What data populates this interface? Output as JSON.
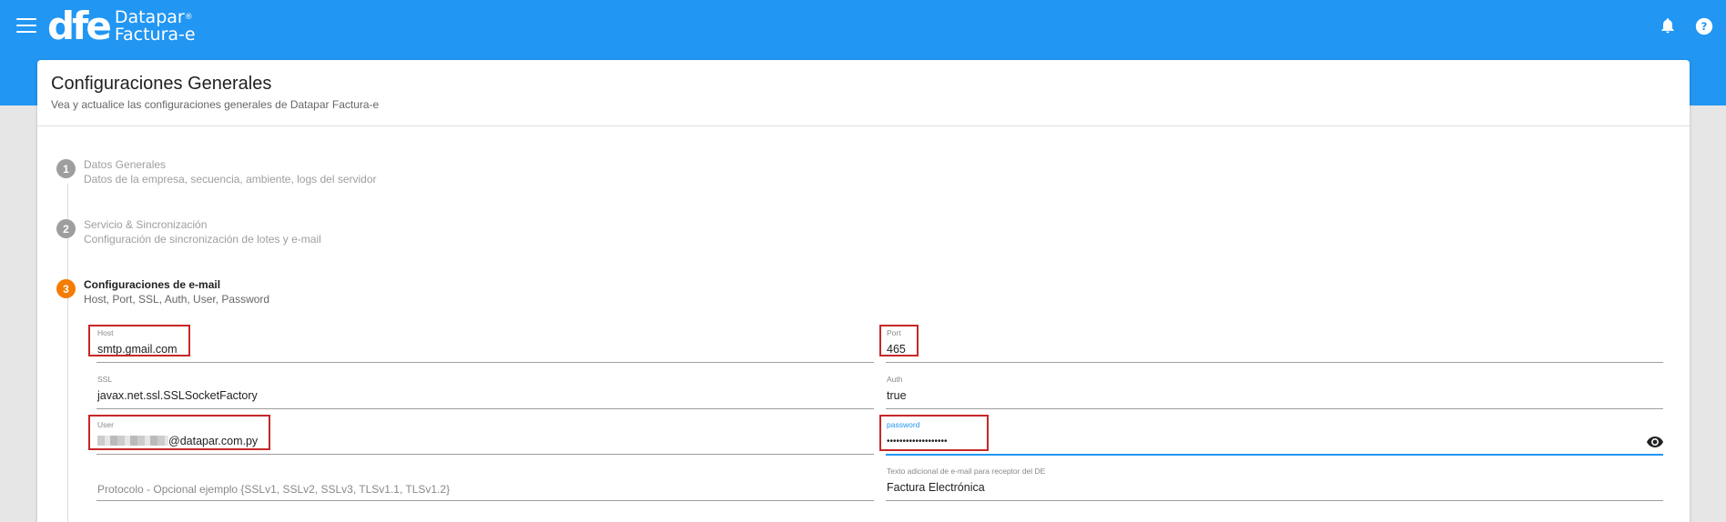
{
  "app": {
    "logo_mark": "dfe",
    "logo_line1": "Datapar",
    "logo_line2": "Factura-e",
    "registered": "®"
  },
  "header": {
    "title": "Configuraciones Generales",
    "subtitle": "Vea y actualice las configuraciones generales de Datapar Factura-e"
  },
  "steps": [
    {
      "number": "1",
      "title": "Datos Generales",
      "desc": "Datos de la empresa, secuencia, ambiente, logs del servidor",
      "active": false
    },
    {
      "number": "2",
      "title": "Servicio & Sincronización",
      "desc": "Configuración de sincronización de lotes y e-mail",
      "active": false
    },
    {
      "number": "3",
      "title": "Configuraciones de e-mail",
      "desc": "Host, Port, SSL, Auth, User, Password",
      "active": true
    }
  ],
  "form": {
    "host": {
      "label": "Host",
      "value": "smtp.gmail.com"
    },
    "port": {
      "label": "Port",
      "value": "465"
    },
    "ssl": {
      "label": "SSL",
      "value": "javax.net.ssl.SSLSocketFactory"
    },
    "auth": {
      "label": "Auth",
      "value": "true"
    },
    "user": {
      "label": "User",
      "value": "@datapar.com.py"
    },
    "password": {
      "label": "password",
      "value": "•••••••••••••••••••"
    },
    "protocolo": {
      "placeholder": "Protocolo - Opcional ejemplo {SSLv1, SSLv2, SSLv3, TLSv1.1, TLSv1.2}"
    },
    "texto_adicional": {
      "label": "Texto adicional de e-mail para receptor del DE",
      "value": "Factura Electrónica"
    }
  },
  "colors": {
    "primary": "#2196f3",
    "active_step": "#f57c00",
    "highlight": "#c62828"
  }
}
